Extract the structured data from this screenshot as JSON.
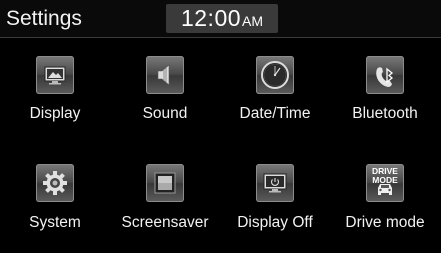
{
  "header": {
    "title": "Settings",
    "time": "12:00",
    "ampm": "AM"
  },
  "menu": {
    "items": [
      {
        "label": "Display",
        "icon": "display-icon"
      },
      {
        "label": "Sound",
        "icon": "speaker-icon"
      },
      {
        "label": "Date/Time",
        "icon": "clock-icon"
      },
      {
        "label": "Bluetooth",
        "icon": "bluetooth-phone-icon"
      },
      {
        "label": "System",
        "icon": "gear-icon"
      },
      {
        "label": "Screensaver",
        "icon": "screensaver-icon"
      },
      {
        "label": "Display Off",
        "icon": "display-power-icon"
      },
      {
        "label": "Drive mode",
        "icon": "car-icon",
        "icon_text": "DRIVE\nMODE"
      }
    ]
  }
}
